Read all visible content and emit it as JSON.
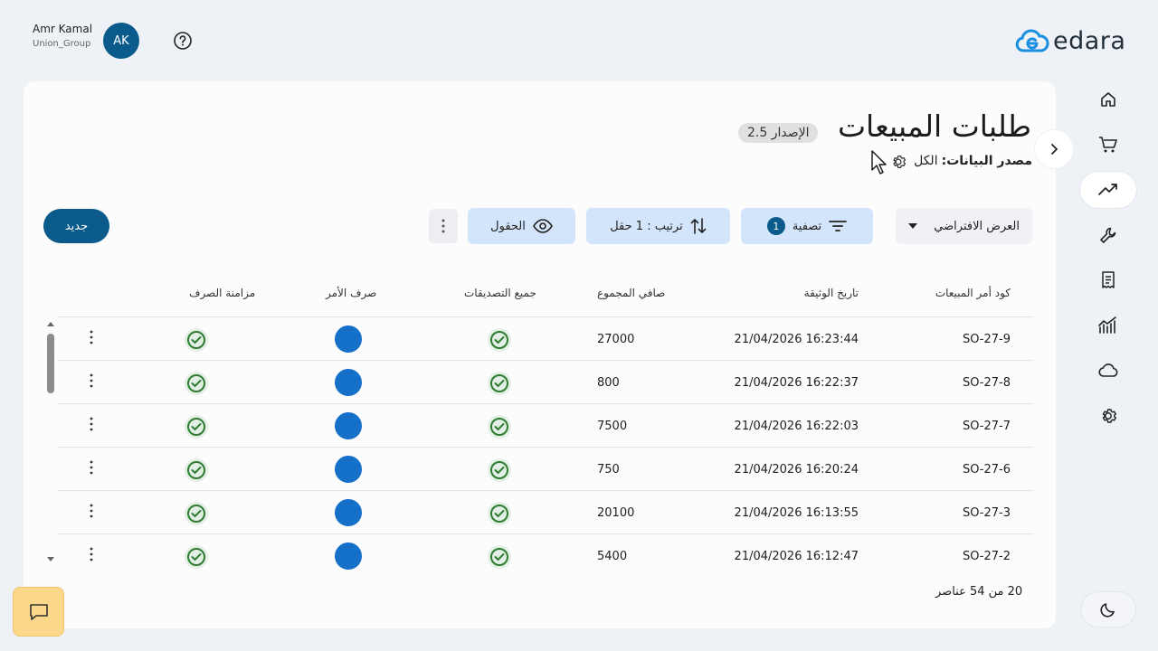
{
  "user": {
    "name": "Amr Kamal",
    "org": "Union_Group",
    "initials": "AK"
  },
  "logo": {
    "text": "edara"
  },
  "page": {
    "title": "طلبات المبيعات",
    "version": "الإصدار 2.5",
    "source_label": "مصدر البيانات:",
    "source_value": "الكل"
  },
  "toolbar": {
    "new_label": "جديد",
    "view_label": "العرض الافتراضي",
    "filter_label": "تصفية",
    "filter_count": "1",
    "sort_label": "ترتيب : 1 حقل",
    "fields_label": "الحقول"
  },
  "table": {
    "headers": {
      "code": "كود أمر المبيعات",
      "date": "تاريخ الوثيقة",
      "total": "صافي المجموع",
      "approvals": "جميع التصديقات",
      "disburse": "صرف الأمر",
      "sync": "مزامنة الصرف"
    },
    "rows": [
      {
        "code": "SO-27-9",
        "date": "21/04/2026 16:23:44",
        "total": "27000"
      },
      {
        "code": "SO-27-8",
        "date": "21/04/2026 16:22:37",
        "total": "800"
      },
      {
        "code": "SO-27-7",
        "date": "21/04/2026 16:22:03",
        "total": "7500"
      },
      {
        "code": "SO-27-6",
        "date": "21/04/2026 16:20:24",
        "total": "750"
      },
      {
        "code": "SO-27-3",
        "date": "21/04/2026 16:13:55",
        "total": "20100"
      },
      {
        "code": "SO-27-2",
        "date": "21/04/2026 16:12:47",
        "total": "5400"
      }
    ],
    "pager": "20 من 54 عناصر"
  },
  "sidebar": {
    "items": [
      "home-icon",
      "cart-icon",
      "trending-up-icon",
      "wrench-icon",
      "receipt-icon",
      "analytics-icon",
      "cloud-icon",
      "settings-icon"
    ],
    "active": "trending-up-icon"
  },
  "colors": {
    "primary": "#0a5a8c",
    "accent_blue": "#1570c9",
    "chip_bg": "#d3e5fa",
    "check_green": "#2e7d32",
    "chat_bg": "#fcd88a"
  }
}
